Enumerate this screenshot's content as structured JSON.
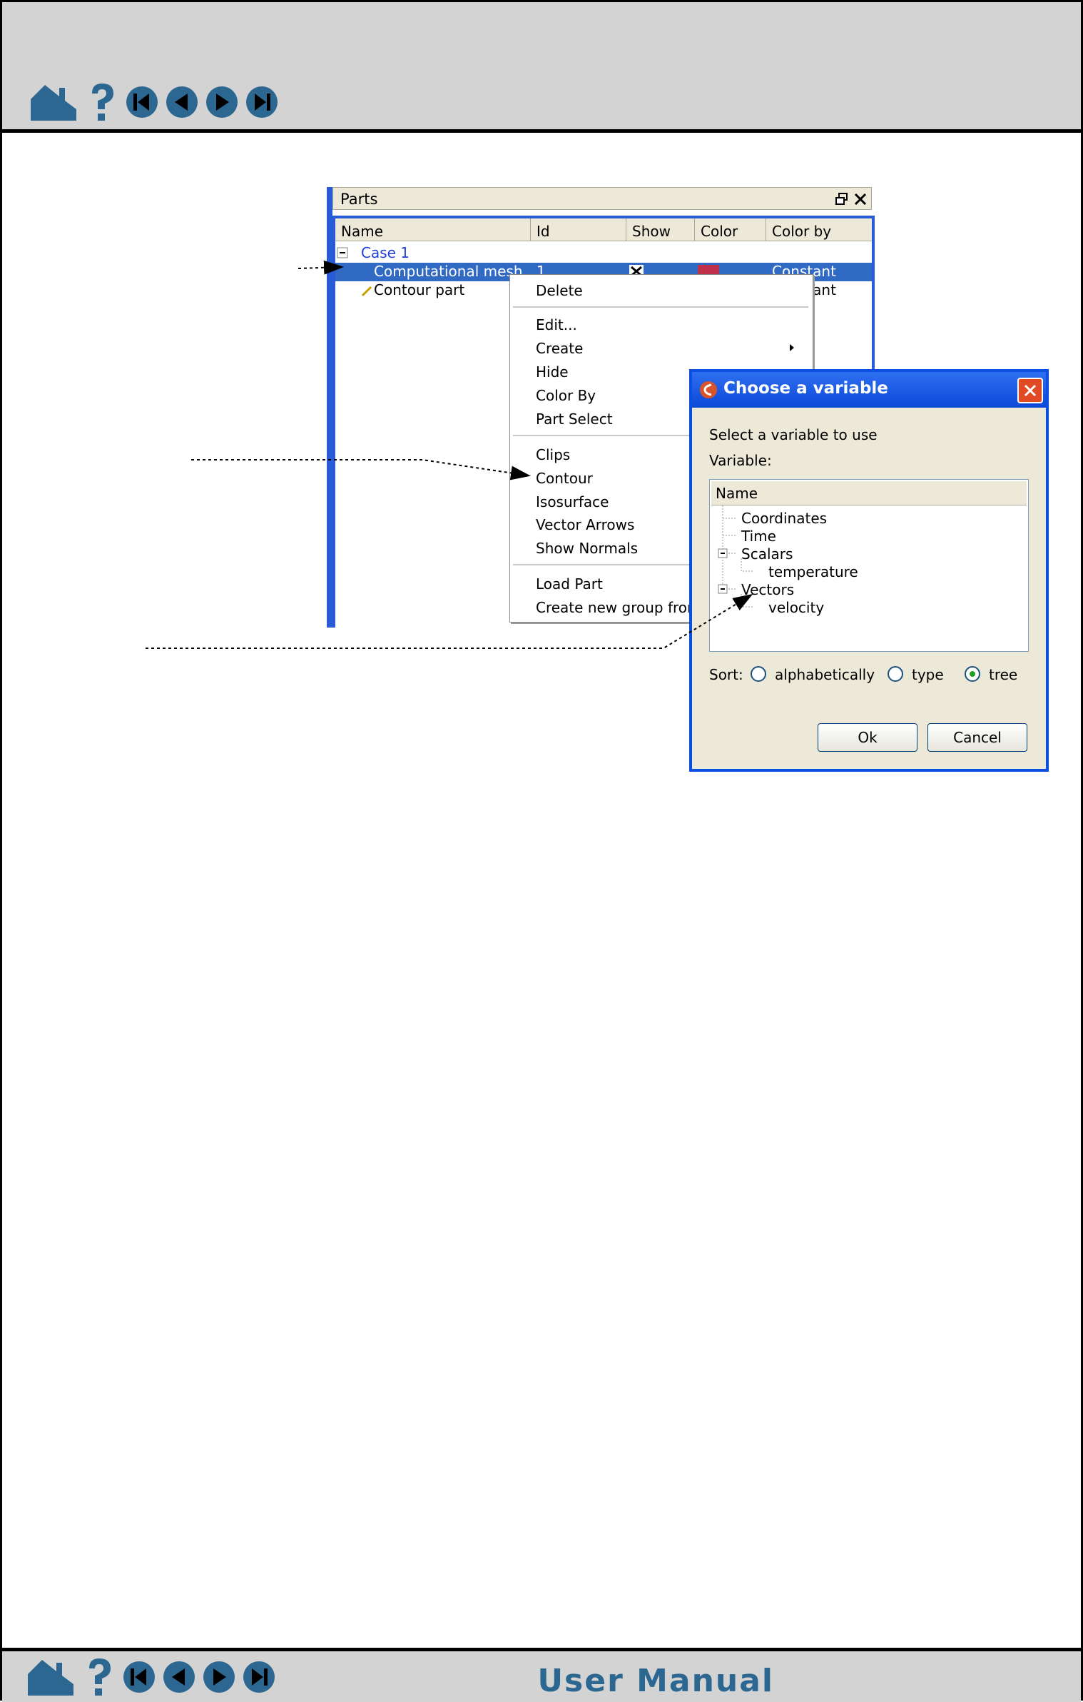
{
  "nav_icons": [
    "home-icon",
    "help-icon",
    "first-page-icon",
    "previous-page-icon",
    "next-page-icon",
    "last-page-icon"
  ],
  "footer": {
    "title": "User Manual"
  },
  "parts_panel": {
    "title": "Parts",
    "columns": [
      "Name",
      "Id",
      "Show",
      "Color",
      "Color by"
    ],
    "case_label": "Case 1",
    "rows": [
      {
        "name": "Computational mesh",
        "id": "1",
        "color_by": "Constant"
      },
      {
        "name": "Contour part",
        "color_by": "Constant"
      }
    ]
  },
  "context_menu": {
    "items": [
      "Delete",
      "Edit...",
      "Create",
      "Hide",
      "Color By",
      "Part Select",
      "Clips",
      "Contour",
      "Isosurface",
      "Vector Arrows",
      "Show Normals",
      "Load Part",
      "Create new group from"
    ]
  },
  "dialog": {
    "title": "Choose a variable",
    "prompt": "Select a variable to use",
    "variable_label": "Variable:",
    "tree_header": "Name",
    "tree_items": [
      "Coordinates",
      "Time",
      "Scalars",
      "temperature",
      "Vectors",
      "velocity"
    ],
    "sort_label": "Sort:",
    "sort_options": [
      "alphabetically",
      "type",
      "tree"
    ],
    "sort_selected": "tree",
    "ok_label": "Ok",
    "cancel_label": "Cancel"
  },
  "colors": {
    "selection": "#316ac5",
    "xp_blue": "#0a4fe0",
    "nav_icon": "#2c6791",
    "mesh_color": "#c0304a"
  }
}
